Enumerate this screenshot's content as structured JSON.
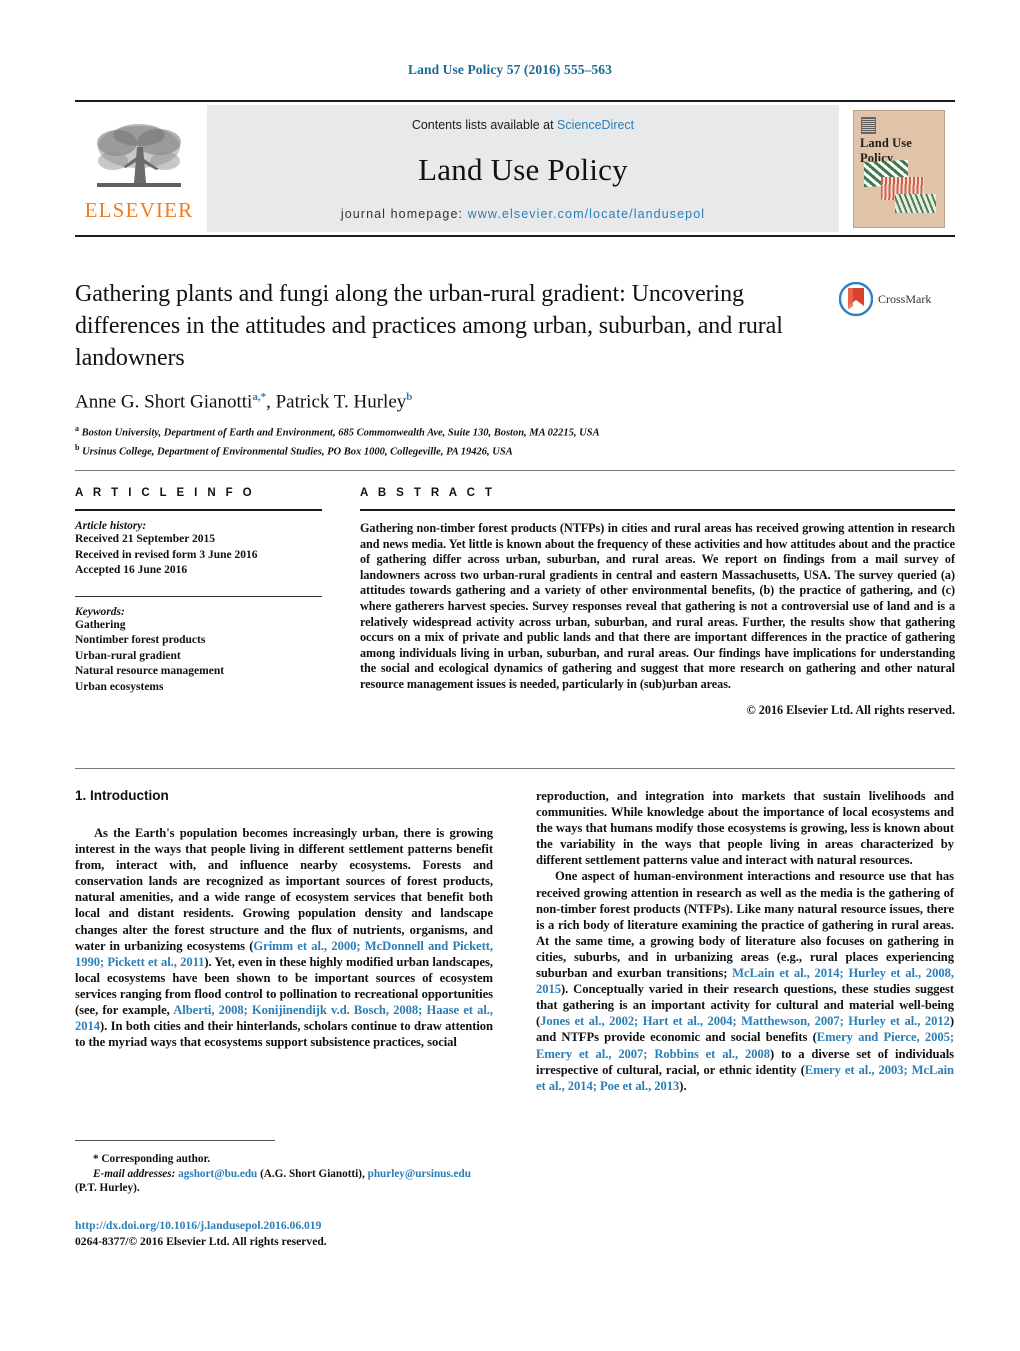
{
  "running_head": "Land Use Policy 57 (2016) 555–563",
  "masthead": {
    "publisher": "ELSEVIER",
    "contents_prefix": "Contents lists available at ",
    "contents_link": "ScienceDirect",
    "journal_name": "Land Use Policy",
    "homepage_prefix": "journal homepage: ",
    "homepage_url": "www.elsevier.com/locate/landusepol",
    "cover_title": "Land Use Policy"
  },
  "article": {
    "title": "Gathering plants and fungi along the urban-rural gradient: Uncovering differences in the attitudes and practices among urban, suburban, and rural landowners",
    "crossmark_label": "CrossMark",
    "authors_html": "Anne G. Short Gianotti<sup>a,*</sup>, Patrick T. Hurley<sup>b</sup>",
    "affiliations": [
      "a Boston University, Department of Earth and Environment, 685 Commonwealth Ave, Suite 130, Boston, MA 02215, USA",
      "b Ursinus College, Department of Environmental Studies, PO Box 1000, Collegeville, PA 19426, USA"
    ]
  },
  "article_info": {
    "heading": "A R T I C L E   I N F O",
    "history_label": "Article history:",
    "history": [
      "Received 21 September 2015",
      "Received in revised form 3 June 2016",
      "Accepted 16 June 2016"
    ],
    "keywords_label": "Keywords:",
    "keywords": [
      "Gathering",
      "Nontimber forest products",
      "Urban-rural gradient",
      "Natural resource management",
      "Urban ecosystems"
    ]
  },
  "abstract": {
    "heading": "A B S T R A C T",
    "text": "Gathering non-timber forest products (NTFPs) in cities and rural areas has received growing attention in research and news media. Yet little is known about the frequency of these activities and how attitudes about and the practice of gathering differ across urban, suburban, and rural areas. We report on findings from a mail survey of landowners across two urban-rural gradients in central and eastern Massachusetts, USA. The survey queried (a) attitudes towards gathering and a variety of other environmental benefits, (b) the practice of gathering, and (c) where gatherers harvest species. Survey responses reveal that gathering is not a controversial use of land and is a relatively widespread activity across urban, suburban, and rural areas. Further, the results show that gathering occurs on a mix of private and public lands and that there are important differences in the practice of gathering among individuals living in urban, suburban, and rural areas. Our findings have implications for understanding the social and ecological dynamics of gathering and suggest that more research on gathering and other natural resource management issues is needed, particularly in (sub)urban areas.",
    "copyright": "© 2016 Elsevier Ltd. All rights reserved."
  },
  "body": {
    "section_title": "1.  Introduction",
    "left_para_1_a": "As the Earth's population becomes increasingly urban, there is growing interest in the ways that people living in different settlement patterns benefit from, interact with, and influence nearby ecosystems. Forests and conservation lands are recognized as important sources of forest products, natural amenities, and a wide range of ecosystem services that benefit both local and distant residents. Growing population density and landscape changes alter the forest structure and the flux of nutrients, organisms, and water in urbanizing ecosystems (",
    "left_cite_1": "Grimm et al., 2000; McDonnell and Pickett, 1990; Pickett et al., 2011",
    "left_para_1_b": "). Yet, even in these highly modified urban landscapes, local ecosystems have been shown to be important sources of ecosystem services ranging from flood control to pollination to recreational opportunities (see, for example, ",
    "left_cite_2": "Alberti, 2008; Konijinendijk v.d. Bosch, 2008; Haase et al., 2014",
    "left_para_1_c": "). In both cities and their hinterlands, scholars continue to draw attention to the myriad ways that ecosystems support subsistence practices, social",
    "right_para_1": "reproduction, and integration into markets that sustain livelihoods and communities. While knowledge about the importance of local ecosystems and the ways that humans modify those ecosystems is growing, less is known about the variability in the ways that people living in areas characterized by different settlement patterns value and interact with natural resources.",
    "right_para_2_a": "One aspect of human-environment interactions and resource use that has received growing attention in research as well as the media is the gathering of non-timber forest products (NTFPs). Like many natural resource issues, there is a rich body of literature examining the practice of gathering in rural areas. At the same time, a growing body of literature also focuses on gathering in cities, suburbs, and in urbanizing areas (e.g., rural places experiencing suburban and exurban transitions; ",
    "right_cite_1": "McLain et al., 2014; Hurley et al., 2008, 2015",
    "right_para_2_b": "). Conceptually varied in their research questions, these studies suggest that gathering is an important activity for cultural and material well-being (",
    "right_cite_2": "Jones et al., 2002; Hart et al., 2004; Matthewson, 2007; Hurley et al., 2012",
    "right_para_2_c": ") and NTFPs provide economic and social benefits (",
    "right_cite_3": "Emery and Pierce, 2005; Emery et al., 2007; Robbins et al., 2008",
    "right_para_2_d": ") to a diverse set of individuals irrespective of cultural, racial, or ethnic identity (",
    "right_cite_4": "Emery et al., 2003; McLain et al., 2014; Poe et al., 2013",
    "right_para_2_e": ")."
  },
  "footnote": {
    "corresponding": "* Corresponding author.",
    "email_label": "E-mail addresses:",
    "email_1": "agshort@bu.edu",
    "email_1_owner": "(A.G. Short Gianotti),",
    "email_2": "phurley@ursinus.edu",
    "email_2_owner": "(P.T. Hurley)."
  },
  "doi": {
    "url": "http://dx.doi.org/10.1016/j.landusepol.2016.06.019",
    "issn_line": "0264-8377/© 2016 Elsevier Ltd. All rights reserved."
  },
  "colors": {
    "link": "#2a7fb8",
    "elsevier_orange": "#F47B20",
    "band_gray": "#e8e9ea"
  }
}
